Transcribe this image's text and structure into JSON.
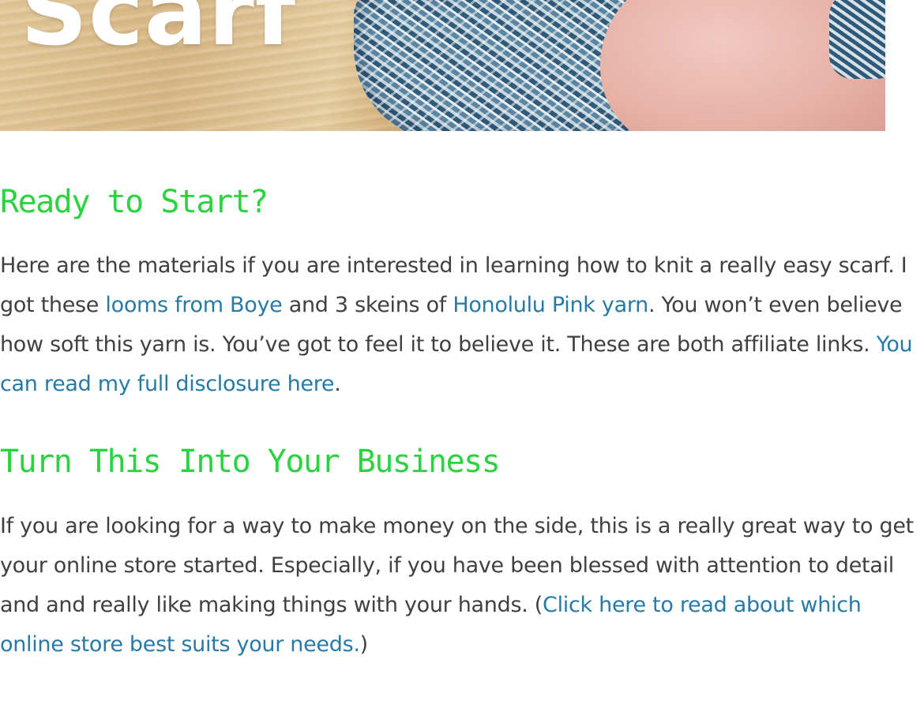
{
  "hero": {
    "title": "Scarf"
  },
  "sections": [
    {
      "heading": "Ready to Start?",
      "paragraph": {
        "t1": "Here are the materials if you are interested in learning how to knit a really easy scarf. I got these ",
        "link1": "looms from Boye",
        "t2": " and 3 skeins of ",
        "link2": "Honolulu Pink yarn",
        "t3": ". You won’t even believe how soft this yarn is. You’ve got to feel it to believe it. These are both affiliate links. ",
        "link3": "You can read my full disclosure here",
        "t4": "."
      }
    },
    {
      "heading": "Turn This Into Your Business",
      "paragraph": {
        "t1": "If you are looking for a way to make money on the side, this is a really great way to get your online store started. Especially, if you have been blessed with attention to detail and and really like making things with your hands. (",
        "link1": "Click here to read about which online store best suits your needs.",
        "t2": ")"
      }
    }
  ],
  "colors": {
    "heading": "#2bd341",
    "body_text": "#404040",
    "link": "#267aa5"
  }
}
